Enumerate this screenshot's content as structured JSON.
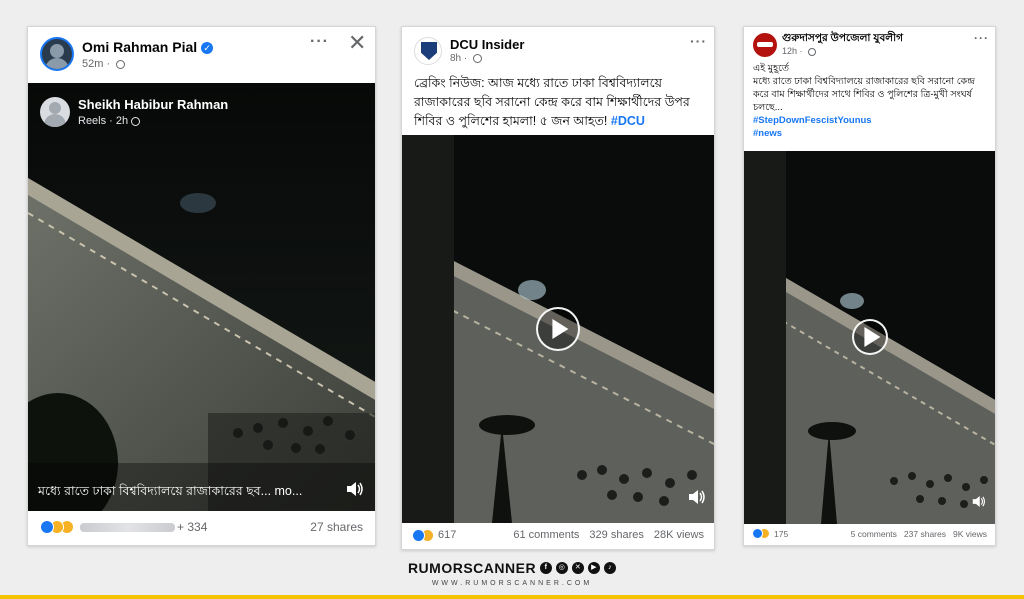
{
  "posts": [
    {
      "author": "Omi Rahman Pial",
      "time": "52m",
      "shared_author": "Sheikh Habibur Rahman",
      "shared_meta": "Reels · 2h",
      "caption": "মধ্যে রাতে ঢাকা বিশ্ববিদ্যালয়ে রাজাকারের ছব... mo...",
      "reactions_count": "+ 334",
      "shares": "27 shares"
    },
    {
      "author": "DCU Insider",
      "time": "8h",
      "text": "ব্রেকিং নিউজ: আজ মধ্যে রাতে ঢাকা বিশ্ববিদ্যালয়ে রাজাকারের ছবি সরানো কেন্দ্র করে বাম শিক্ষার্থীদের উপর শিবির ও পুলিশের হামলা! ৫ জন আহত!",
      "hashtag": "#DCU",
      "reactions_count": "617",
      "comments": "61 comments",
      "shares": "329 shares",
      "views": "28K views"
    },
    {
      "author": "গুরুদাসপুর উপজেলা যুবলীগ",
      "time": "12h",
      "line1": "এই মুহূর্তে",
      "text": "মধ্যে রাতে ঢাকা বিশ্ববিদ্যালয়ে রাজাকারের ছবি সরানো কেন্দ্র করে বাম শিক্ষার্থীদের সাথে শিবির ও পুলিশের ত্রি-মুখী সংঘর্ষ চলছে...",
      "hashtag1": "#StepDownFescistYounus",
      "hashtag2": "#news",
      "reactions_count": "175",
      "comments": "5 comments",
      "shares": "237 shares",
      "views": "9K views"
    }
  ],
  "footer": {
    "brand": "RUMORSCANNER",
    "url": "WWW.RUMORSCANNER.COM"
  },
  "colors": {
    "accent": "#1877f2",
    "brand_bar": "#f5c400",
    "hashtag": "#1877f2"
  }
}
